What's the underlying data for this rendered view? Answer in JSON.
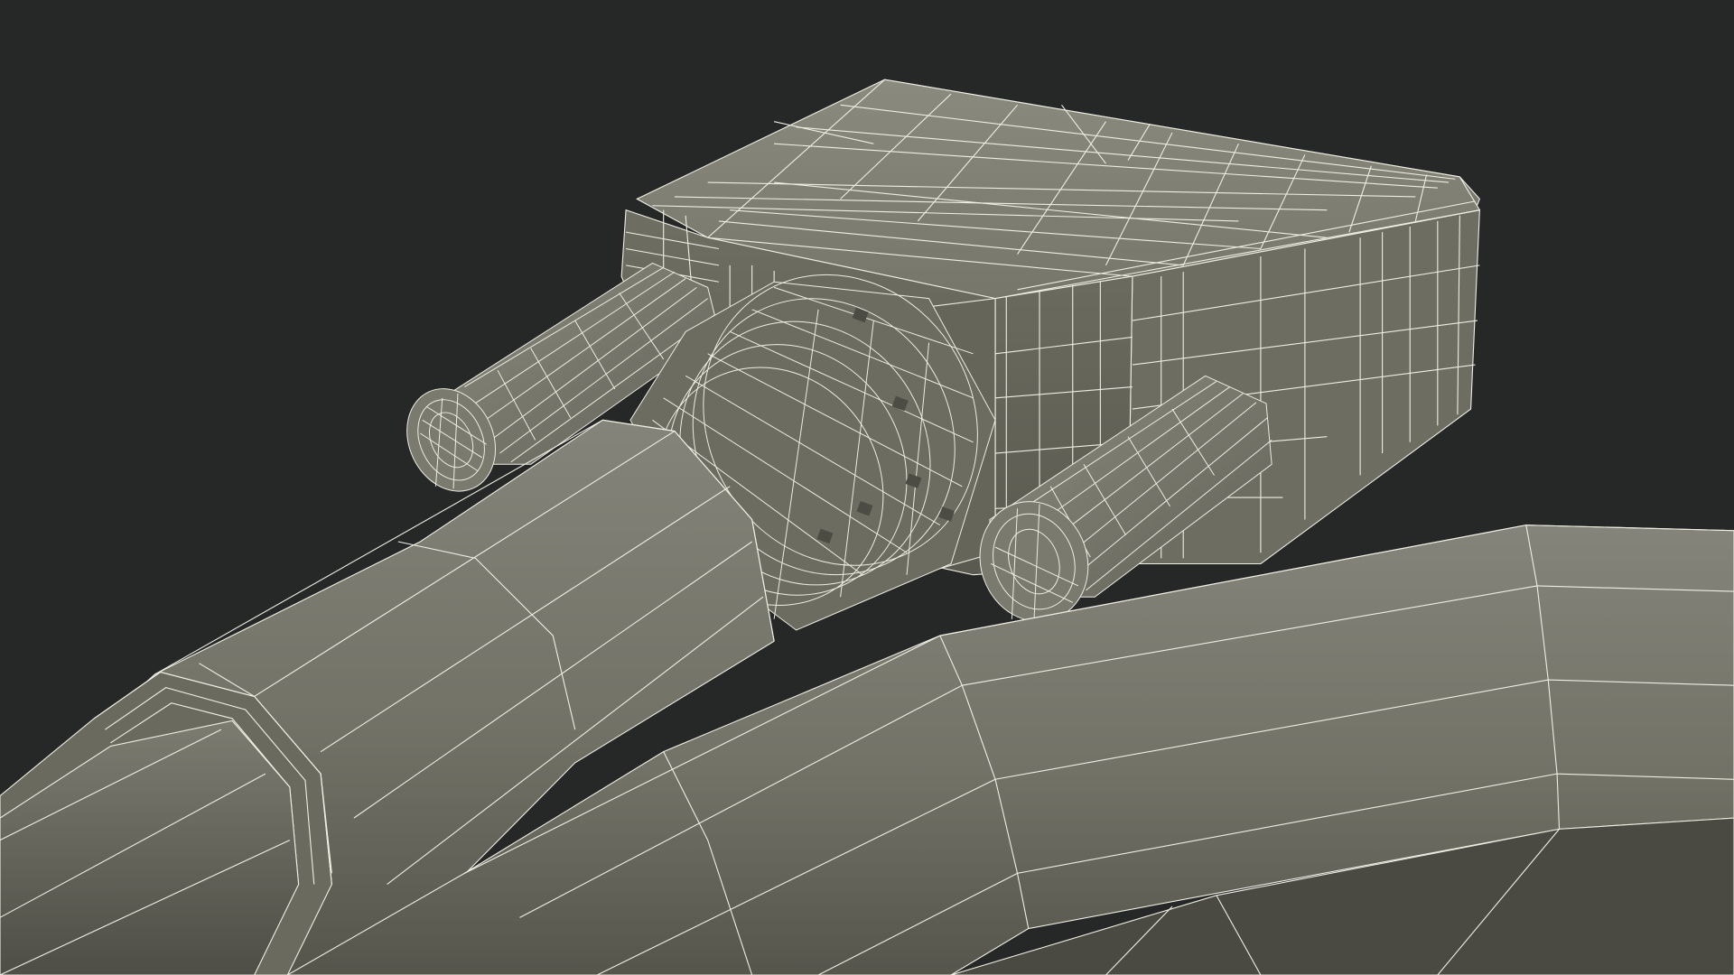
{
  "scene": {
    "subject": "dvi-cable-connector-wireframe",
    "render_mode": "wireframe-on-shaded",
    "colors": {
      "background": "#262727",
      "surface": "#7b7b6e",
      "surface_dark": "#5f5f55",
      "surface_light": "#8a8a7d",
      "wire": "#eeeee4"
    }
  }
}
